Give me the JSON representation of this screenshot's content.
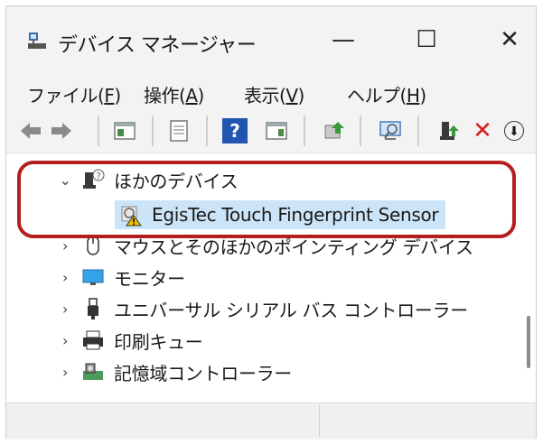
{
  "window": {
    "title": "デバイス マネージャー",
    "minimize_glyph": "—",
    "maximize_glyph": "☐",
    "close_glyph": "✕"
  },
  "menu": [
    {
      "label": "ファイル(",
      "key": "F",
      "suffix": ")"
    },
    {
      "label": "操作(",
      "key": "A",
      "suffix": ")"
    },
    {
      "label": "表示(",
      "key": "V",
      "suffix": ")"
    },
    {
      "label": "ヘルプ(",
      "key": "H",
      "suffix": ")"
    }
  ],
  "toolbar": {
    "icons": [
      "back-arrow-icon",
      "forward-arrow-icon",
      "show-hide-console-tree-icon",
      "properties-icon",
      "help-icon",
      "action-pane-icon",
      "update-driver-icon",
      "scan-hardware-icon",
      "enable-device-icon",
      "uninstall-device-icon",
      "disable-device-icon"
    ],
    "help_glyph": "?",
    "uninstall_glyph": "✕",
    "disable_glyph": "⬇"
  },
  "tree": {
    "items": [
      {
        "label": "ほかのデバイス",
        "expanded": true,
        "chevron": "⌄",
        "icon": "unknown-device-category-icon"
      },
      {
        "label": "EgisTec Touch Fingerprint Sensor",
        "selected": true,
        "icon": "warning-device-icon"
      },
      {
        "label": "マウスとそのほかのポインティング デバイス",
        "chevron": "›",
        "icon": "mouse-icon"
      },
      {
        "label": "モニター",
        "chevron": "›",
        "icon": "monitor-icon"
      },
      {
        "label": "ユニバーサル シリアル バス コントローラー",
        "chevron": "›",
        "icon": "usb-icon"
      },
      {
        "label": "印刷キュー",
        "chevron": "›",
        "icon": "printer-icon"
      },
      {
        "label": "記憶域コントローラー",
        "chevron": "›",
        "icon": "storage-controller-icon"
      }
    ]
  },
  "colors": {
    "highlight": "#b51e1e",
    "selection": "#cce4f7",
    "chrome": "#f3f3f3"
  }
}
